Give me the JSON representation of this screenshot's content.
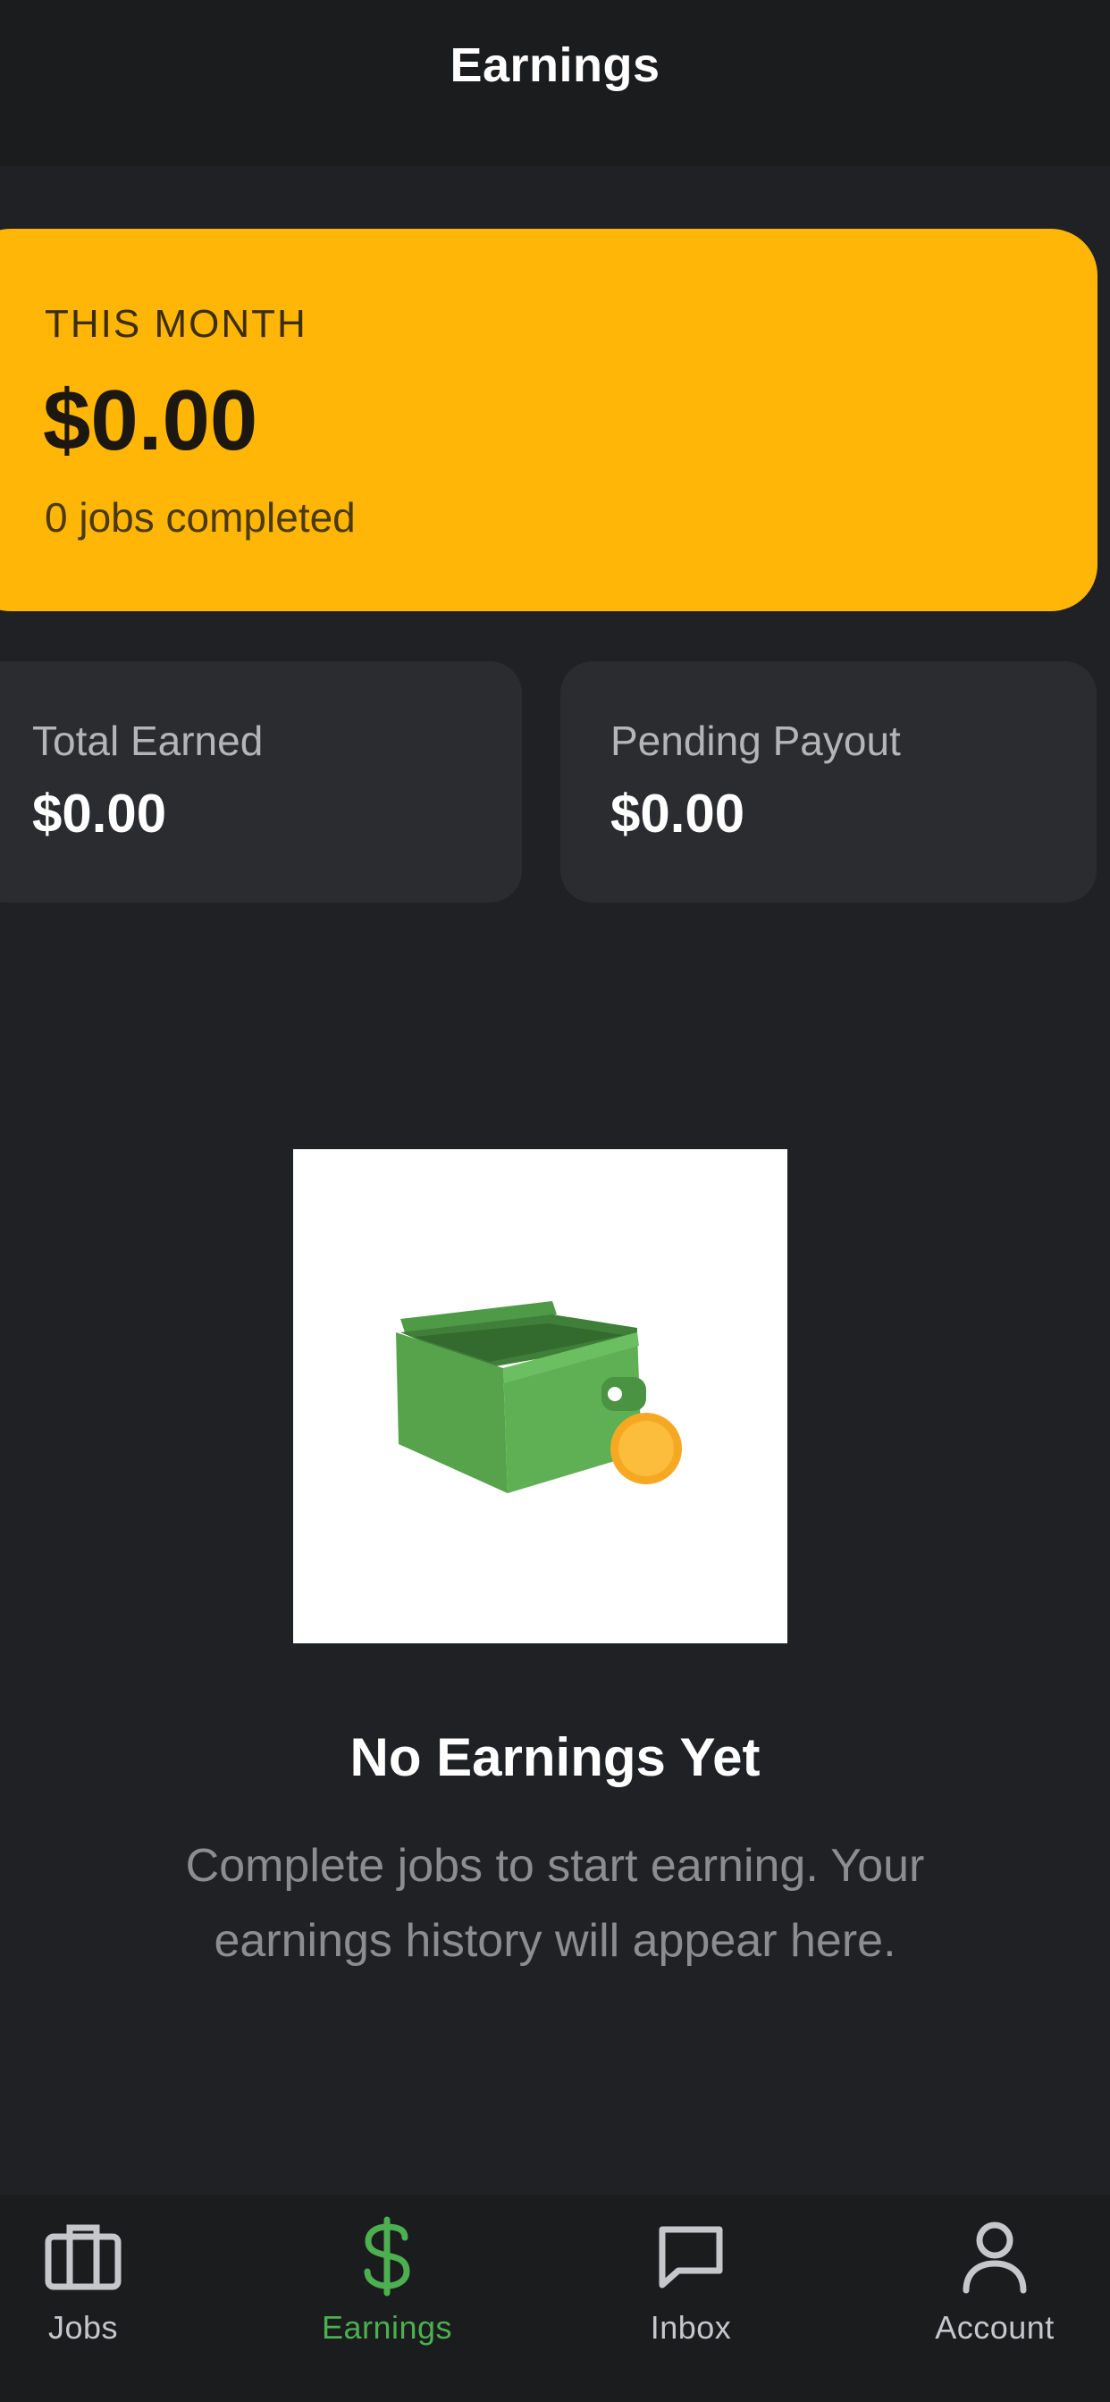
{
  "header": {
    "title": "Earnings"
  },
  "month_card": {
    "label": "THIS MONTH",
    "amount": "$0.00",
    "jobs": "0 jobs completed"
  },
  "stats": {
    "total_label": "Total Earned",
    "total_value": "$0.00",
    "pending_label": "Pending Payout",
    "pending_value": "$0.00"
  },
  "empty_state": {
    "icon": "wallet-with-coin-illustration",
    "title": "No Earnings Yet",
    "description": "Complete jobs to start earning. Your earnings history will appear here."
  },
  "nav": {
    "items": [
      {
        "label": "Jobs",
        "icon": "briefcase-icon",
        "active": false
      },
      {
        "label": "Earnings",
        "icon": "dollar-icon",
        "active": true
      },
      {
        "label": "Inbox",
        "icon": "chat-bubble-icon",
        "active": false
      },
      {
        "label": "Account",
        "icon": "user-icon",
        "active": false
      }
    ]
  },
  "colors": {
    "background": "#202124",
    "accent_yellow": "#ffb606",
    "active_green": "#4caf50",
    "card": "#2b2c2f"
  }
}
